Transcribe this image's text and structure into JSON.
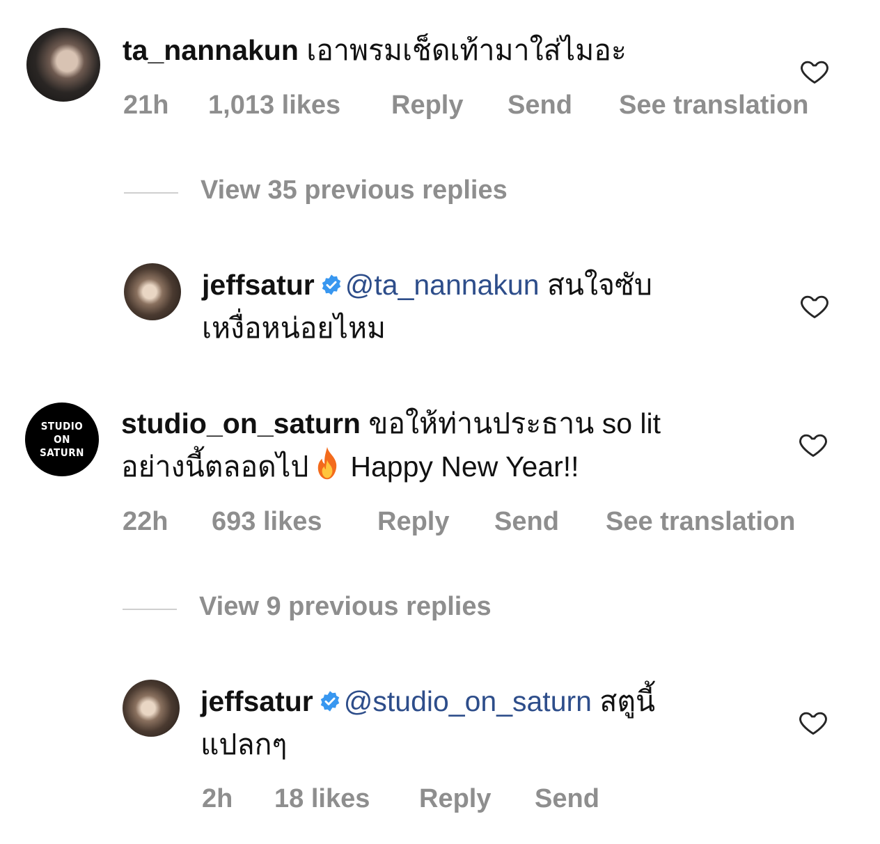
{
  "comments": [
    {
      "username": "ta_nannakun",
      "text": "เอาพรมเช็ดเท้ามาใส่ไมอะ",
      "meta": {
        "time": "21h",
        "likes": "1,013 likes",
        "reply": "Reply",
        "send": "Send",
        "translate": "See translation"
      },
      "view_replies": "View 35 previous replies",
      "reply": {
        "username": "jeffsatur",
        "mention": "@ta_nannakun",
        "text_line1": "สนใจซับ",
        "text_line2": "เหงื่อหน่อยไหม"
      }
    },
    {
      "username": "studio_on_saturn",
      "avatar_text": [
        "STUDIO",
        "ON",
        "SATURN"
      ],
      "text_line1": "ขอให้ท่านประธาน so lit",
      "text_line2a": "อย่างนี้ตลอดไป",
      "emoji": "fire-emoji",
      "text_line2b": "Happy New Year!!",
      "meta": {
        "time": "22h",
        "likes": "693 likes",
        "reply": "Reply",
        "send": "Send",
        "translate": "See translation"
      },
      "view_replies": "View 9 previous replies",
      "reply": {
        "username": "jeffsatur",
        "mention": "@studio_on_saturn",
        "text_line1": "สตูนี้",
        "text_line2": "แปลกๆ",
        "meta": {
          "time": "2h",
          "likes": "18 likes",
          "reply": "Reply",
          "send": "Send"
        }
      }
    }
  ],
  "colors": {
    "mention": "#2d4d8a",
    "meta": "#8e8e8e",
    "verified": "#3897f0"
  }
}
